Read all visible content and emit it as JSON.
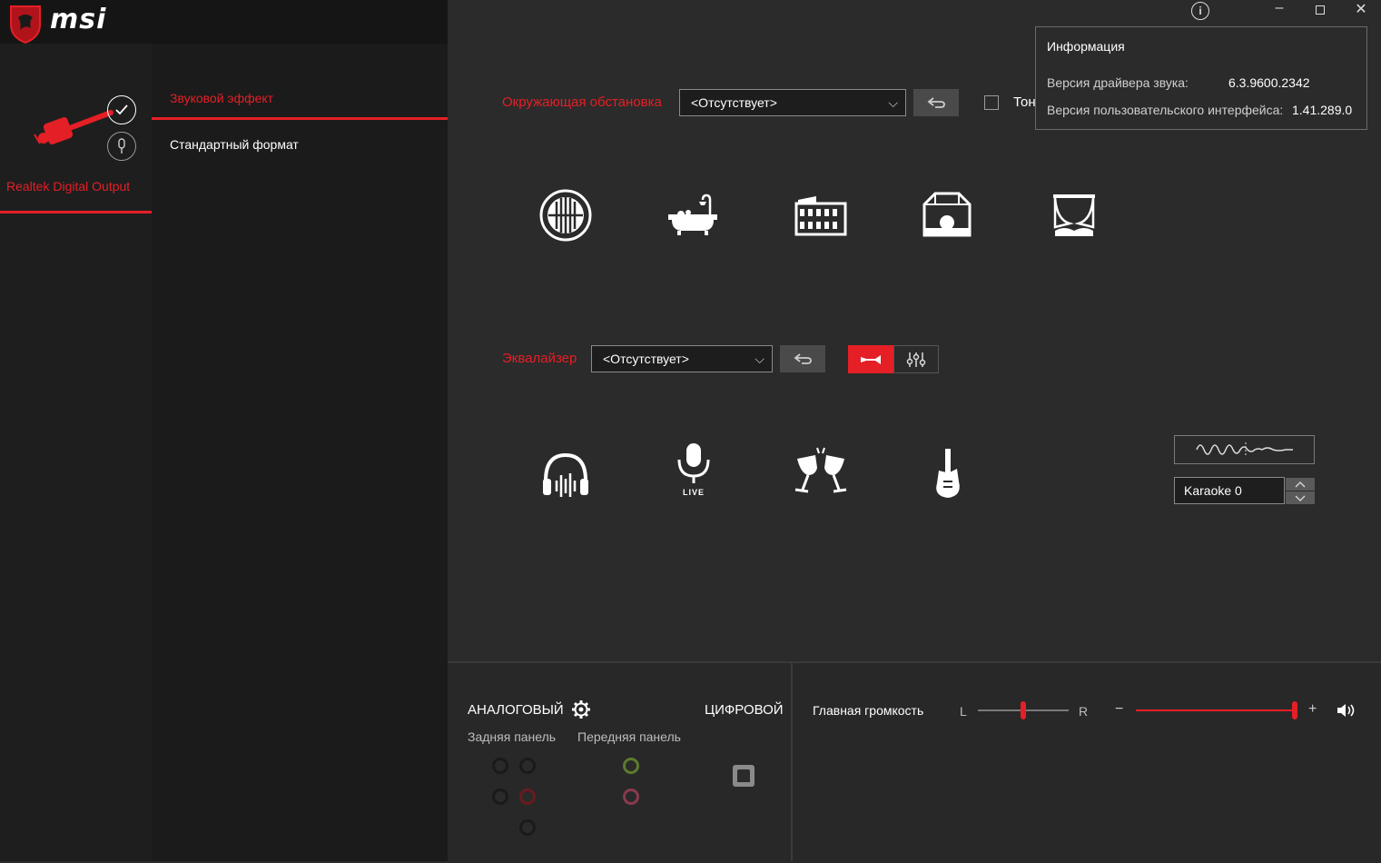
{
  "brand": {
    "logo_text": "msi"
  },
  "device": {
    "name": "Realtek Digital Output"
  },
  "nav": {
    "items": [
      {
        "label": "Звуковой эффект",
        "active": true
      },
      {
        "label": "Стандартный формат",
        "active": false
      }
    ]
  },
  "environment": {
    "label": "Окружающая обстановка",
    "selected": "<Отсутствует>",
    "tone_label": "Тон",
    "icons": [
      "sewer-pipe-icon",
      "bathroom-icon",
      "colosseum-icon",
      "stage-icon",
      "theater-icon"
    ]
  },
  "equalizer": {
    "label": "Эквалайзер",
    "selected": "<Отсутствует>",
    "icons": [
      "headphones-icon",
      "live-mic-icon",
      "party-icon",
      "rock-guitar-icon"
    ],
    "live_text": "LIVE"
  },
  "karaoke": {
    "value": "Karaoke 0"
  },
  "info": {
    "title": "Информация",
    "driver_label": "Версия драйвера звука:",
    "driver_value": "6.3.9600.2342",
    "ui_label": "Версия пользовательского интерфейса:",
    "ui_value": "1.41.289.0"
  },
  "bottom": {
    "analog": "АНАЛОГОВЫЙ",
    "digital": "ЦИФРОВОЙ",
    "rear_panel": "Задняя панель",
    "front_panel": "Передняя панель",
    "master_volume": "Главная громкость",
    "balance_left": "L",
    "balance_right": "R",
    "vol_minus": "−",
    "vol_plus": "+",
    "volume_level": 1.0,
    "balance_level": 0.5
  },
  "colors": {
    "accent": "#e41f26",
    "background": "#2b2b2b"
  }
}
